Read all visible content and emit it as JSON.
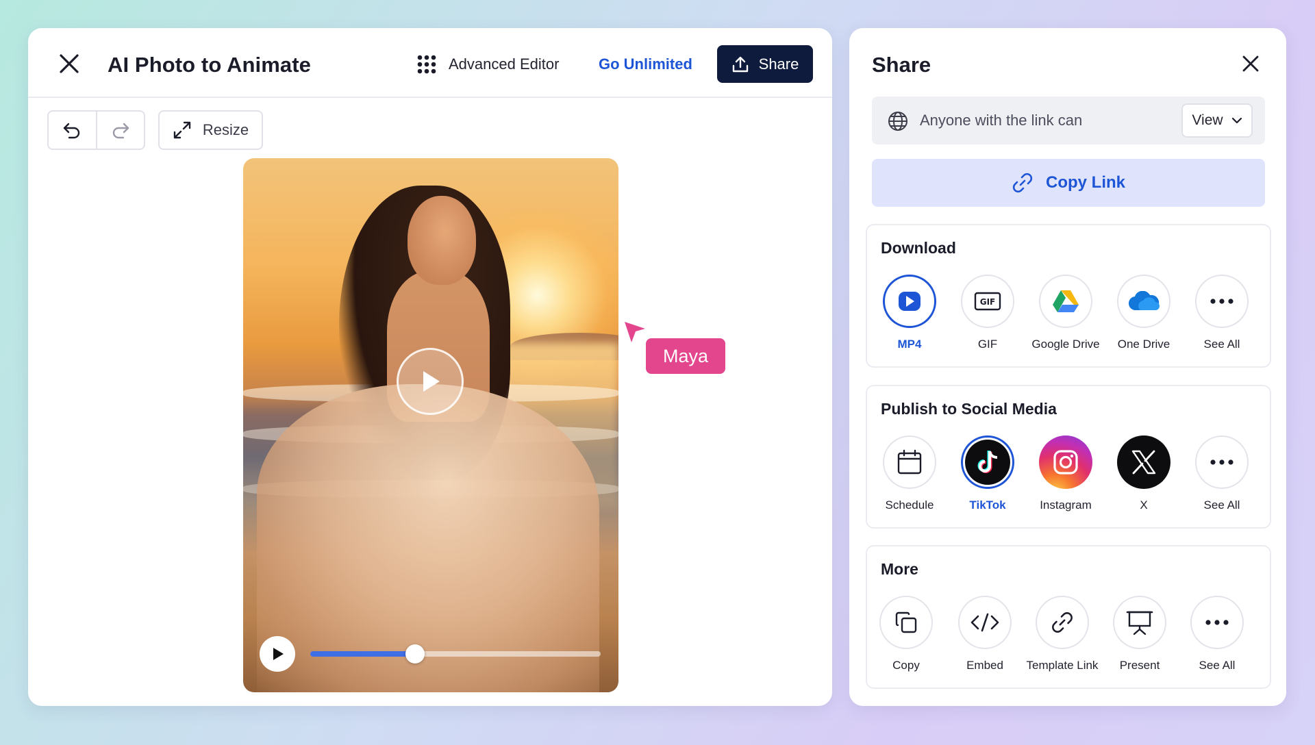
{
  "editor": {
    "title": "AI Photo to Animate",
    "advanced_editor_label": "Advanced Editor",
    "go_unlimited_label": "Go Unlimited",
    "share_button_label": "Share",
    "resize_label": "Resize",
    "video": {
      "progress": 0.36
    }
  },
  "collaborator": {
    "name": "Maya",
    "color": "#e4468e"
  },
  "share_panel": {
    "title": "Share",
    "link_access_text": "Anyone with the link can",
    "permission_value": "View",
    "copy_link_label": "Copy Link",
    "download": {
      "title": "Download",
      "options": [
        {
          "label": "MP4",
          "icon": "mp4-play-icon",
          "selected": true
        },
        {
          "label": "GIF",
          "icon": "gif-icon"
        },
        {
          "label": "Google Drive",
          "icon": "google-drive-icon"
        },
        {
          "label": "One Drive",
          "icon": "onedrive-cloud-icon"
        },
        {
          "label": "See All",
          "icon": "more-dots-icon"
        }
      ]
    },
    "social": {
      "title": "Publish to Social Media",
      "options": [
        {
          "label": "Schedule",
          "icon": "calendar-icon"
        },
        {
          "label": "TikTok",
          "icon": "tiktok-icon",
          "selected": true
        },
        {
          "label": "Instagram",
          "icon": "instagram-icon"
        },
        {
          "label": "X",
          "icon": "x-logo-icon"
        },
        {
          "label": "See All",
          "icon": "more-dots-icon"
        }
      ]
    },
    "more": {
      "title": "More",
      "options": [
        {
          "label": "Copy",
          "icon": "copy-icon"
        },
        {
          "label": "Embed",
          "icon": "embed-code-icon"
        },
        {
          "label": "Template Link",
          "icon": "link-icon"
        },
        {
          "label": "Present",
          "icon": "present-screen-icon"
        },
        {
          "label": "See All",
          "icon": "more-dots-icon"
        }
      ]
    }
  },
  "colors": {
    "accent": "#1d55d6",
    "share_button_bg": "#0e1b3d",
    "copy_link_bg": "#dfe4fc"
  }
}
